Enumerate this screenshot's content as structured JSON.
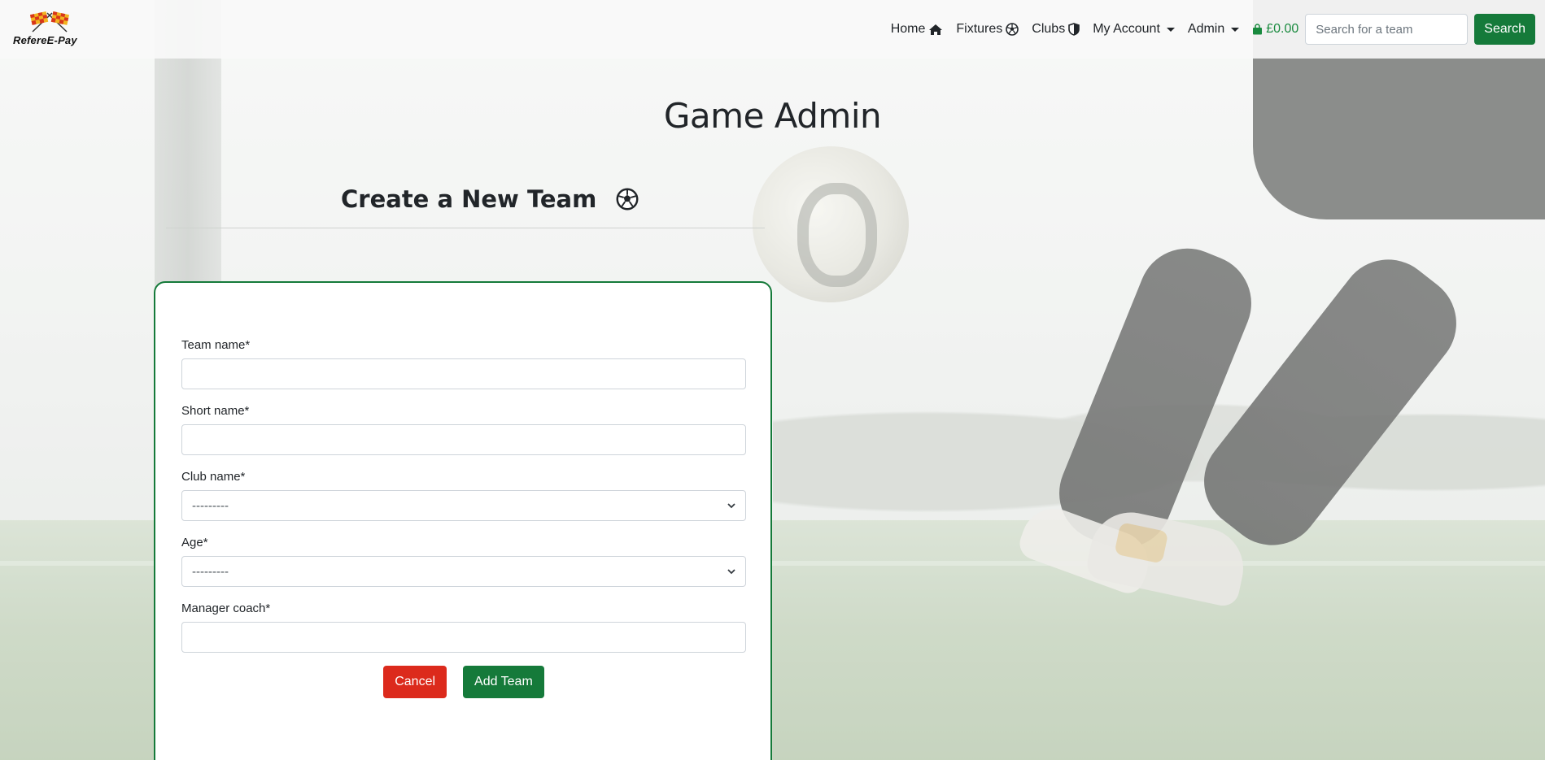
{
  "brand": {
    "name": "RefereE-Pay"
  },
  "nav": {
    "home": "Home",
    "fixtures": "Fixtures",
    "clubs": "Clubs",
    "my_account": "My Account",
    "admin": "Admin",
    "bag_total": "£0.00",
    "search_placeholder": "Search for a team",
    "search_button": "Search"
  },
  "page": {
    "title": "Game Admin",
    "section_title": "Create a New Team"
  },
  "form": {
    "team_name": {
      "label": "Team name*",
      "value": ""
    },
    "short_name": {
      "label": "Short name*",
      "value": ""
    },
    "club_name": {
      "label": "Club name*",
      "selected": "---------"
    },
    "age": {
      "label": "Age*",
      "selected": "---------"
    },
    "manager_coach": {
      "label": "Manager coach*",
      "value": ""
    },
    "cancel": "Cancel",
    "submit": "Add Team"
  },
  "colors": {
    "primary_green": "#157a3a",
    "cancel_red": "#dc2a1c",
    "bag_green": "#198a3e"
  },
  "icons": {
    "home": "home-icon",
    "fixtures": "football-icon",
    "clubs": "shield-icon",
    "bag": "shopping-bag-icon",
    "section": "football-icon"
  }
}
